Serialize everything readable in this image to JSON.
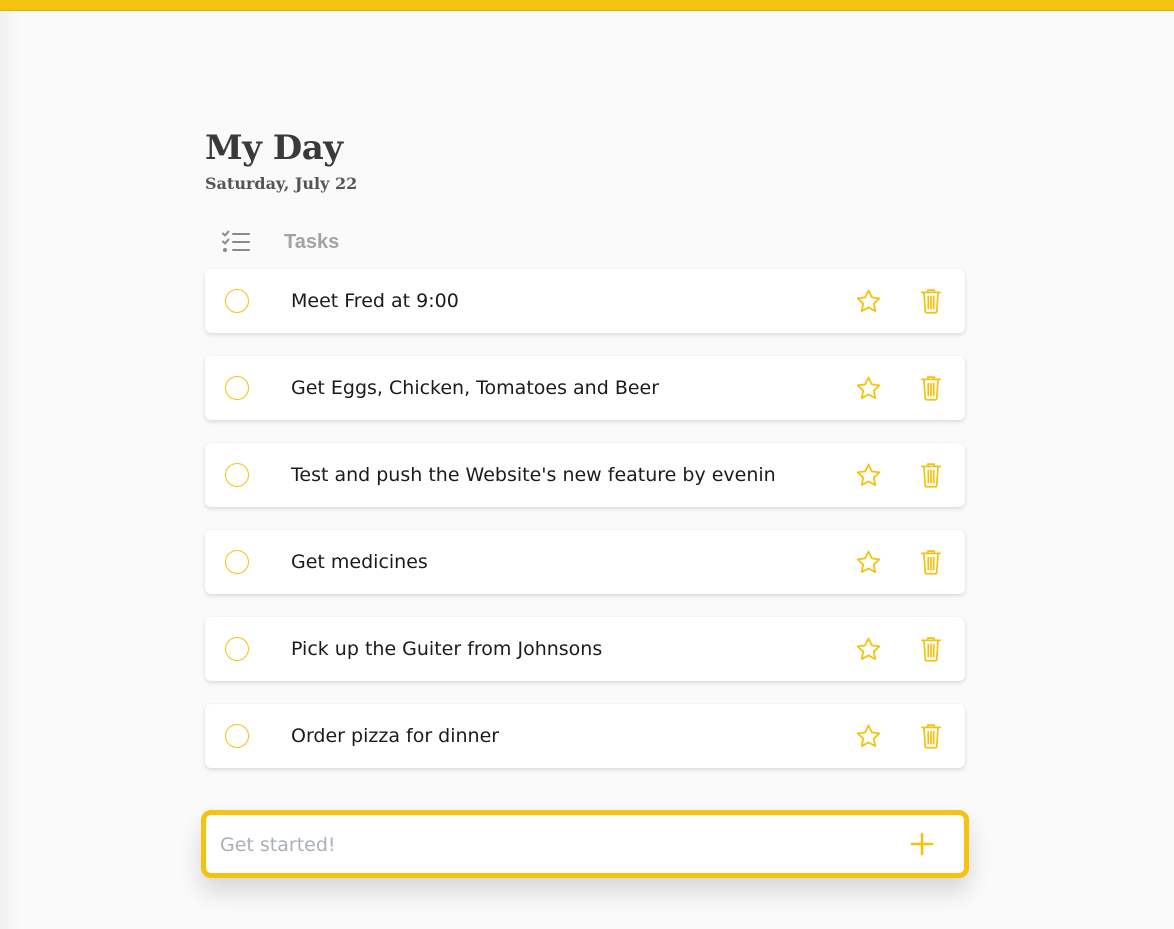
{
  "header": {
    "title": "My Day",
    "date": "Saturday, July 22"
  },
  "section": {
    "label": "Tasks",
    "icon": "checklist-icon"
  },
  "tasks": [
    {
      "text": "Meet Fred at 9:00"
    },
    {
      "text": "Get Eggs, Chicken, Tomatoes and Beer"
    },
    {
      "text": "Test and push the Website's new feature by evenin"
    },
    {
      "text": "Get medicines"
    },
    {
      "text": "Pick up the Guiter from Johnsons"
    },
    {
      "text": "Order pizza for dinner"
    }
  ],
  "new_task": {
    "placeholder": "Get started!",
    "value": ""
  },
  "colors": {
    "accent": "#f5c20f",
    "background": "#fafafa",
    "title": "#3a3a3a",
    "muted": "#a3a3a3"
  },
  "icons": {
    "check": "circle-outline",
    "star": "star-outline-icon",
    "trash": "trash-icon",
    "add": "plus-icon"
  }
}
